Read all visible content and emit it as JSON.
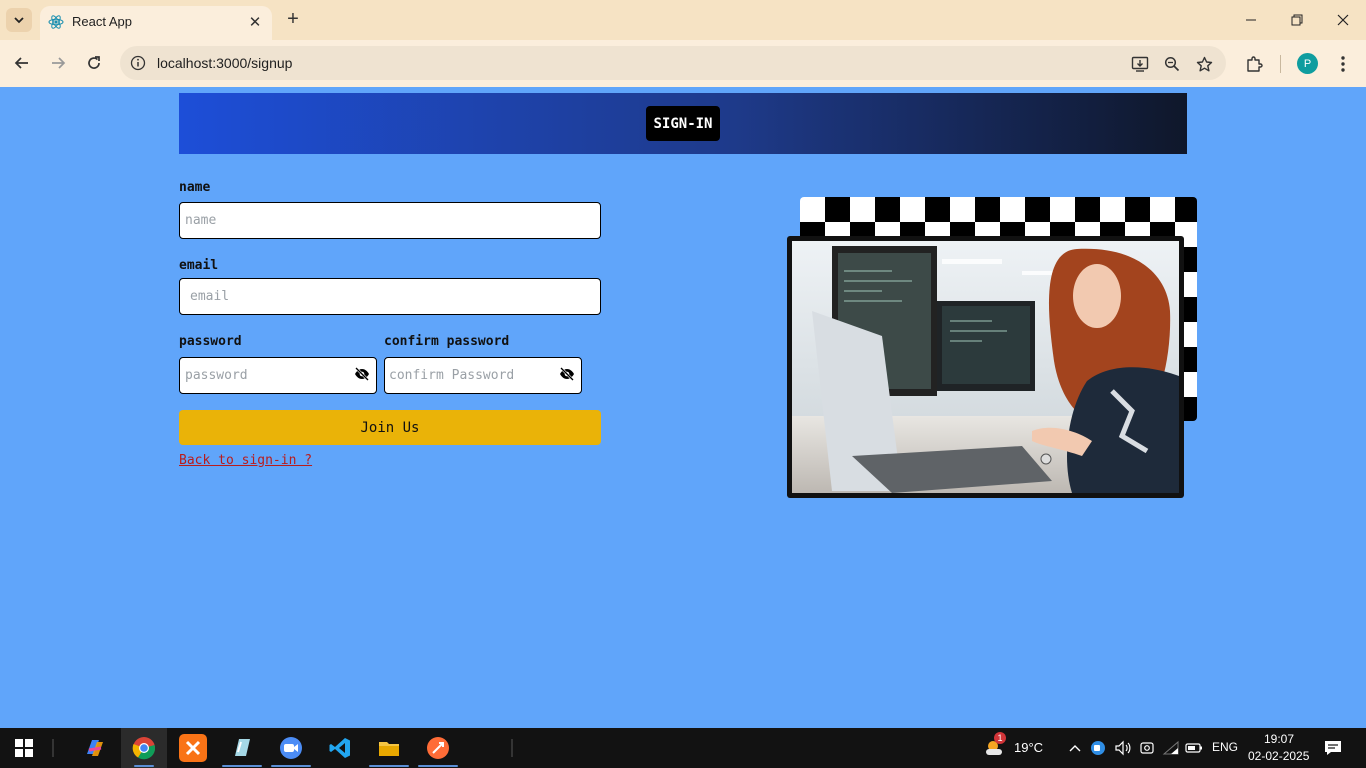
{
  "browser": {
    "tab_title": "React App",
    "tab_close": "✕",
    "new_tab": "+",
    "url": "localhost:3000/signup"
  },
  "header": {
    "signin_label": "SIGN-IN"
  },
  "form": {
    "name_label": "name",
    "name_placeholder": "name",
    "email_label": "email",
    "email_placeholder": "email",
    "password_label": "password",
    "password_placeholder": "password",
    "confirm_label": "confirm password",
    "confirm_placeholder": "confirm Password",
    "submit_label": "Join Us",
    "back_link": "Back to sign-in ?"
  },
  "taskbar": {
    "weather_temp": "19°C",
    "weather_badge": "1",
    "language": "ENG",
    "time": "19:07",
    "date": "02-02-2025"
  },
  "colors": {
    "page_bg": "#60a5fa",
    "submit_bg": "#eab308",
    "link": "#b91c1c"
  }
}
